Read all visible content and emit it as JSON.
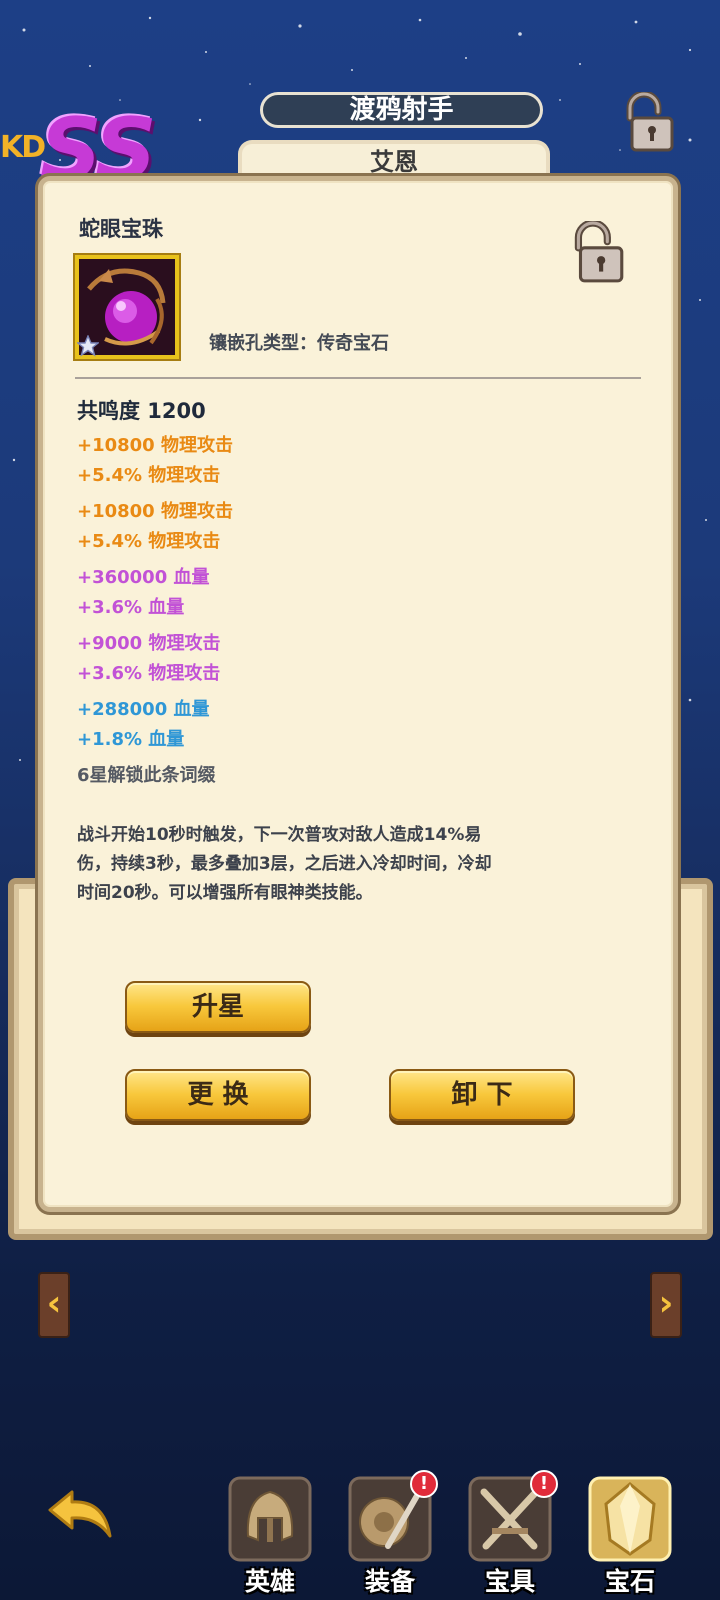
{
  "header": {
    "rank_prefix": "KD",
    "rank": "SS",
    "hero_title": "渡鸦射手",
    "hero_name": "艾恩"
  },
  "gem": {
    "name": "蛇眼宝珠",
    "socket_type": "镶嵌孔类型：传奇宝石",
    "stars": 1,
    "resonance": "共鸣度 1200"
  },
  "stats": [
    {
      "text": "+10800 物理攻击",
      "tier": "orange"
    },
    {
      "text": "+5.4% 物理攻击",
      "tier": "orange"
    },
    {
      "text": "+10800 物理攻击",
      "tier": "orange"
    },
    {
      "text": "+5.4% 物理攻击",
      "tier": "orange"
    },
    {
      "text": "+360000 血量",
      "tier": "purple"
    },
    {
      "text": "+3.6% 血量",
      "tier": "purple"
    },
    {
      "text": "+9000 物理攻击",
      "tier": "purple"
    },
    {
      "text": "+3.6% 物理攻击",
      "tier": "purple"
    },
    {
      "text": "+288000 血量",
      "tier": "blue"
    },
    {
      "text": "+1.8% 血量",
      "tier": "blue"
    },
    {
      "text": "6星解锁此条词缀",
      "tier": "gray"
    }
  ],
  "description": "战斗开始10秒时触发，下一次普攻对敌人造成14%易伤，持续3秒，最多叠加3层，之后进入冷却时间，冷却时间20秒。可以增强所有眼神类技能。",
  "buttons": {
    "upgrade": "升星",
    "replace": "更 换",
    "remove": "卸 下"
  },
  "nav": {
    "prev": "‹",
    "next": "›",
    "items": [
      {
        "label": "英雄",
        "icon": "helmet-icon",
        "badge": false
      },
      {
        "label": "装备",
        "icon": "shield-sword-icon",
        "badge": true
      },
      {
        "label": "宝具",
        "icon": "crossed-swords-icon",
        "badge": true
      },
      {
        "label": "宝石",
        "icon": "gem-icon",
        "badge": false
      }
    ],
    "badge_text": "!"
  },
  "colors": {
    "orange": "#e98a14",
    "purple": "#c252d6",
    "blue": "#2f97d6",
    "gray": "#555a63",
    "button_gold": "#f8c83c"
  }
}
